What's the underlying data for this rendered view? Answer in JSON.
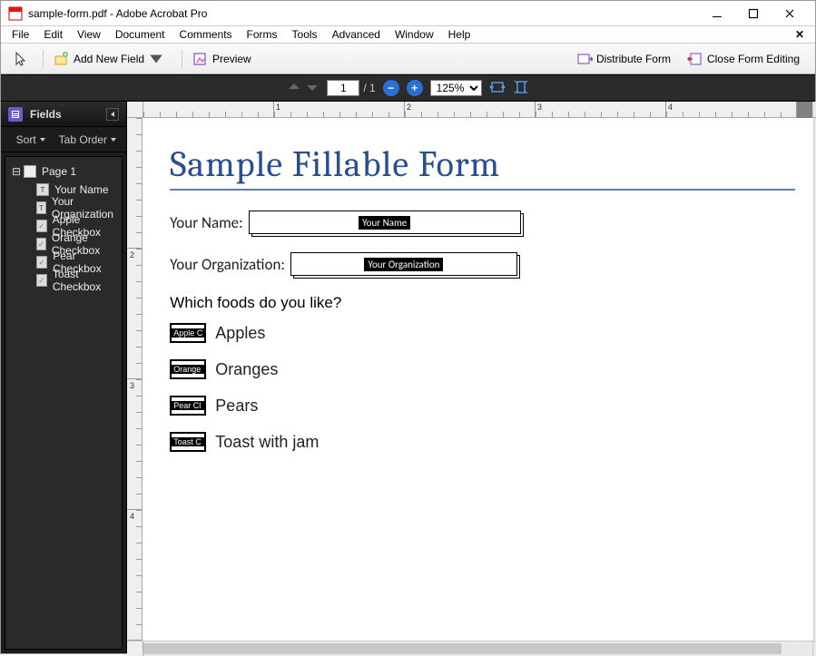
{
  "window": {
    "title": "sample-form.pdf - Adobe Acrobat Pro",
    "menu": [
      "File",
      "Edit",
      "View",
      "Document",
      "Comments",
      "Forms",
      "Tools",
      "Advanced",
      "Window",
      "Help"
    ]
  },
  "toolbar": {
    "add_field": "Add New Field",
    "preview": "Preview",
    "distribute": "Distribute Form",
    "close_editing": "Close Form Editing"
  },
  "nav": {
    "page_current": "1",
    "page_total": "/ 1",
    "zoom": "125%"
  },
  "panel": {
    "title": "Fields",
    "sort": "Sort",
    "tab_order": "Tab Order",
    "page": "Page 1",
    "fields": [
      {
        "kind": "txt",
        "label": "Your Name"
      },
      {
        "kind": "txt",
        "label": "Your Organization"
      },
      {
        "kind": "chk",
        "label": "Apple Checkbox"
      },
      {
        "kind": "chk",
        "label": "Orange Checkbox"
      },
      {
        "kind": "chk",
        "label": "Pear Checkbox"
      },
      {
        "kind": "chk",
        "label": "Toast Checkbox"
      }
    ]
  },
  "ruler_h": [
    "",
    "1",
    "2",
    "3",
    "4"
  ],
  "ruler_v": [
    "",
    "2",
    "3",
    "4"
  ],
  "doc": {
    "title": "Sample Fillable Form",
    "name_label": "Your Name:",
    "name_tag": "Your Name",
    "org_label": "Your Organization:",
    "org_tag": "Your Organization",
    "question": "Which foods do you like?",
    "items": [
      {
        "tag": "Apple C",
        "label": "Apples"
      },
      {
        "tag": "Orange",
        "label": "Oranges"
      },
      {
        "tag": "Pear Cl",
        "label": "Pears"
      },
      {
        "tag": "Toast C",
        "label": "Toast with jam"
      }
    ]
  }
}
